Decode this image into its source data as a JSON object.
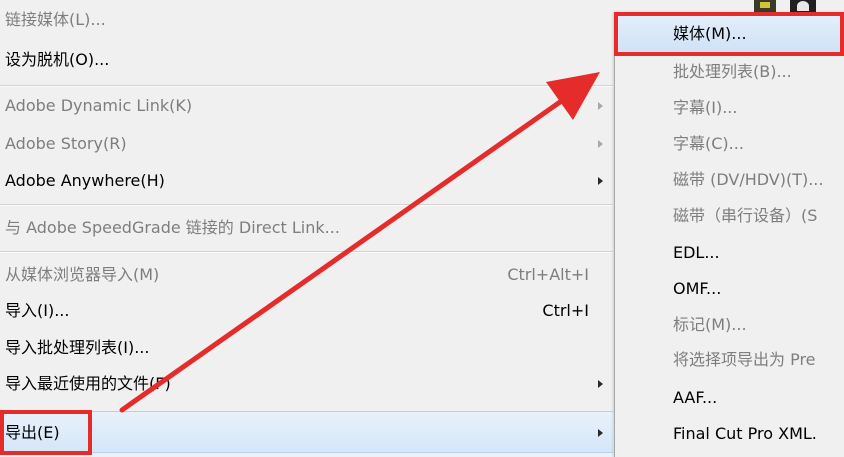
{
  "main_menu": {
    "items": [
      {
        "label": "链接媒体(L)...",
        "shortcut": "",
        "has_submenu": false,
        "disabled": true
      },
      {
        "label": "设为脱机(O)...",
        "shortcut": "",
        "has_submenu": false,
        "disabled": false
      },
      {
        "label": "Adobe Dynamic Link(K)",
        "shortcut": "",
        "has_submenu": true,
        "disabled": true
      },
      {
        "label": "Adobe Story(R)",
        "shortcut": "",
        "has_submenu": true,
        "disabled": true
      },
      {
        "label": "Adobe Anywhere(H)",
        "shortcut": "",
        "has_submenu": true,
        "disabled": false
      },
      {
        "label": "与 Adobe SpeedGrade 链接的 Direct Link...",
        "shortcut": "",
        "has_submenu": false,
        "disabled": true
      },
      {
        "label": "从媒体浏览器导入(M)",
        "shortcut": "Ctrl+Alt+I",
        "has_submenu": false,
        "disabled": true
      },
      {
        "label": "导入(I)...",
        "shortcut": "Ctrl+I",
        "has_submenu": false,
        "disabled": false
      },
      {
        "label": "导入批处理列表(I)...",
        "shortcut": "",
        "has_submenu": false,
        "disabled": false
      },
      {
        "label": "导入最近使用的文件(F)",
        "shortcut": "",
        "has_submenu": true,
        "disabled": false
      },
      {
        "label": "导出(E)",
        "shortcut": "",
        "has_submenu": true,
        "disabled": false,
        "highlighted": true
      }
    ]
  },
  "export_submenu": {
    "items": [
      {
        "label": "媒体(M)...",
        "disabled": false,
        "highlighted": true
      },
      {
        "label": "批处理列表(B)...",
        "disabled": true
      },
      {
        "label": "字幕(I)...",
        "disabled": true
      },
      {
        "label": "字幕(C)...",
        "disabled": true
      },
      {
        "label": "磁带 (DV/HDV)(T)...",
        "disabled": true
      },
      {
        "label": "磁带（串行设备）(S",
        "disabled": true
      },
      {
        "label": "EDL...",
        "disabled": false
      },
      {
        "label": "OMF...",
        "disabled": false
      },
      {
        "label": "标记(M)...",
        "disabled": true
      },
      {
        "label": "将选择项导出为 Pre",
        "disabled": true
      },
      {
        "label": "AAF...",
        "disabled": false
      },
      {
        "label": "Final Cut Pro XML.",
        "disabled": false
      }
    ]
  },
  "annotations": {
    "highlight_color": "#e62b2b"
  },
  "colors": {
    "menu_bg": "#f0f0f0",
    "disabled_text": "#7e7e7e",
    "hover_bg": "#d5e6f8"
  }
}
